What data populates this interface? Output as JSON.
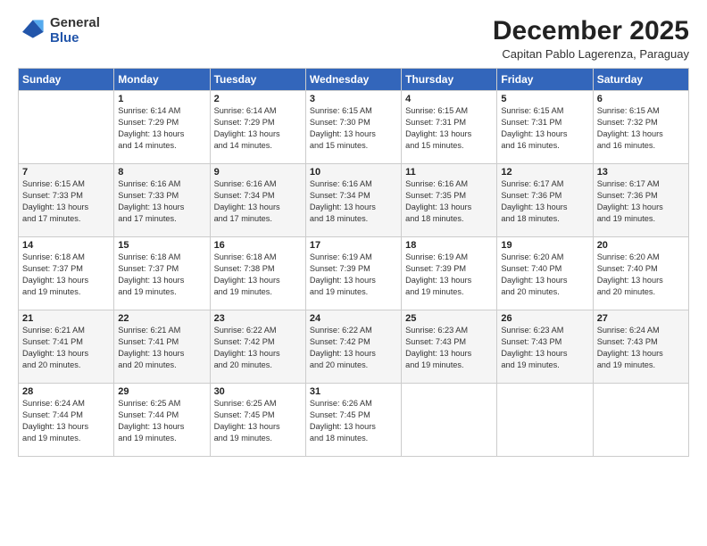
{
  "logo": {
    "general": "General",
    "blue": "Blue"
  },
  "header": {
    "month": "December 2025",
    "location": "Capitan Pablo Lagerenza, Paraguay"
  },
  "weekdays": [
    "Sunday",
    "Monday",
    "Tuesday",
    "Wednesday",
    "Thursday",
    "Friday",
    "Saturday"
  ],
  "weeks": [
    [
      {
        "day": "",
        "info": ""
      },
      {
        "day": "1",
        "info": "Sunrise: 6:14 AM\nSunset: 7:29 PM\nDaylight: 13 hours\nand 14 minutes."
      },
      {
        "day": "2",
        "info": "Sunrise: 6:14 AM\nSunset: 7:29 PM\nDaylight: 13 hours\nand 14 minutes."
      },
      {
        "day": "3",
        "info": "Sunrise: 6:15 AM\nSunset: 7:30 PM\nDaylight: 13 hours\nand 15 minutes."
      },
      {
        "day": "4",
        "info": "Sunrise: 6:15 AM\nSunset: 7:31 PM\nDaylight: 13 hours\nand 15 minutes."
      },
      {
        "day": "5",
        "info": "Sunrise: 6:15 AM\nSunset: 7:31 PM\nDaylight: 13 hours\nand 16 minutes."
      },
      {
        "day": "6",
        "info": "Sunrise: 6:15 AM\nSunset: 7:32 PM\nDaylight: 13 hours\nand 16 minutes."
      }
    ],
    [
      {
        "day": "7",
        "info": "Sunrise: 6:15 AM\nSunset: 7:33 PM\nDaylight: 13 hours\nand 17 minutes."
      },
      {
        "day": "8",
        "info": "Sunrise: 6:16 AM\nSunset: 7:33 PM\nDaylight: 13 hours\nand 17 minutes."
      },
      {
        "day": "9",
        "info": "Sunrise: 6:16 AM\nSunset: 7:34 PM\nDaylight: 13 hours\nand 17 minutes."
      },
      {
        "day": "10",
        "info": "Sunrise: 6:16 AM\nSunset: 7:34 PM\nDaylight: 13 hours\nand 18 minutes."
      },
      {
        "day": "11",
        "info": "Sunrise: 6:16 AM\nSunset: 7:35 PM\nDaylight: 13 hours\nand 18 minutes."
      },
      {
        "day": "12",
        "info": "Sunrise: 6:17 AM\nSunset: 7:36 PM\nDaylight: 13 hours\nand 18 minutes."
      },
      {
        "day": "13",
        "info": "Sunrise: 6:17 AM\nSunset: 7:36 PM\nDaylight: 13 hours\nand 19 minutes."
      }
    ],
    [
      {
        "day": "14",
        "info": "Sunrise: 6:18 AM\nSunset: 7:37 PM\nDaylight: 13 hours\nand 19 minutes."
      },
      {
        "day": "15",
        "info": "Sunrise: 6:18 AM\nSunset: 7:37 PM\nDaylight: 13 hours\nand 19 minutes."
      },
      {
        "day": "16",
        "info": "Sunrise: 6:18 AM\nSunset: 7:38 PM\nDaylight: 13 hours\nand 19 minutes."
      },
      {
        "day": "17",
        "info": "Sunrise: 6:19 AM\nSunset: 7:39 PM\nDaylight: 13 hours\nand 19 minutes."
      },
      {
        "day": "18",
        "info": "Sunrise: 6:19 AM\nSunset: 7:39 PM\nDaylight: 13 hours\nand 19 minutes."
      },
      {
        "day": "19",
        "info": "Sunrise: 6:20 AM\nSunset: 7:40 PM\nDaylight: 13 hours\nand 20 minutes."
      },
      {
        "day": "20",
        "info": "Sunrise: 6:20 AM\nSunset: 7:40 PM\nDaylight: 13 hours\nand 20 minutes."
      }
    ],
    [
      {
        "day": "21",
        "info": "Sunrise: 6:21 AM\nSunset: 7:41 PM\nDaylight: 13 hours\nand 20 minutes."
      },
      {
        "day": "22",
        "info": "Sunrise: 6:21 AM\nSunset: 7:41 PM\nDaylight: 13 hours\nand 20 minutes."
      },
      {
        "day": "23",
        "info": "Sunrise: 6:22 AM\nSunset: 7:42 PM\nDaylight: 13 hours\nand 20 minutes."
      },
      {
        "day": "24",
        "info": "Sunrise: 6:22 AM\nSunset: 7:42 PM\nDaylight: 13 hours\nand 20 minutes."
      },
      {
        "day": "25",
        "info": "Sunrise: 6:23 AM\nSunset: 7:43 PM\nDaylight: 13 hours\nand 19 minutes."
      },
      {
        "day": "26",
        "info": "Sunrise: 6:23 AM\nSunset: 7:43 PM\nDaylight: 13 hours\nand 19 minutes."
      },
      {
        "day": "27",
        "info": "Sunrise: 6:24 AM\nSunset: 7:43 PM\nDaylight: 13 hours\nand 19 minutes."
      }
    ],
    [
      {
        "day": "28",
        "info": "Sunrise: 6:24 AM\nSunset: 7:44 PM\nDaylight: 13 hours\nand 19 minutes."
      },
      {
        "day": "29",
        "info": "Sunrise: 6:25 AM\nSunset: 7:44 PM\nDaylight: 13 hours\nand 19 minutes."
      },
      {
        "day": "30",
        "info": "Sunrise: 6:25 AM\nSunset: 7:45 PM\nDaylight: 13 hours\nand 19 minutes."
      },
      {
        "day": "31",
        "info": "Sunrise: 6:26 AM\nSunset: 7:45 PM\nDaylight: 13 hours\nand 18 minutes."
      },
      {
        "day": "",
        "info": ""
      },
      {
        "day": "",
        "info": ""
      },
      {
        "day": "",
        "info": ""
      }
    ]
  ]
}
